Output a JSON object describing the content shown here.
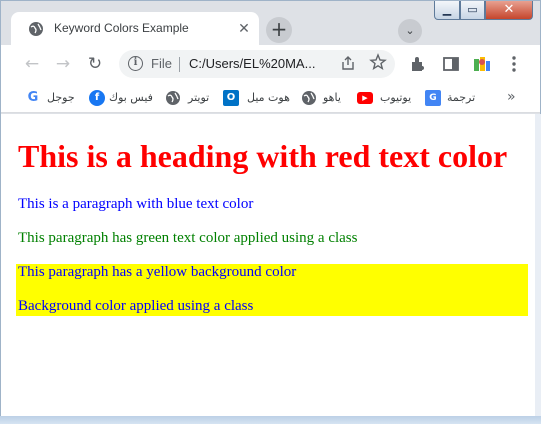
{
  "window": {
    "controls": {
      "minimize": "▁",
      "maximize": "▭",
      "close": "✕"
    }
  },
  "tab": {
    "title": "Keyword Colors Example",
    "favicon": "globe-icon",
    "close": "✕"
  },
  "tabstrip": {
    "new_tab": "+",
    "tab_search": "⌄"
  },
  "toolbar": {
    "back": "←",
    "forward": "→",
    "reload": "↻",
    "scheme": "File",
    "url": "C:/Users/EL%20MA...",
    "icons": [
      "share-icon",
      "bookmark-star-icon",
      "extensions-icon",
      "side-panel-icon",
      "profile-icon",
      "menu-icon"
    ]
  },
  "bookmarks": {
    "items": [
      {
        "label": "جوجل",
        "icon": "google-icon",
        "color": "#4285f4"
      },
      {
        "label": "فيس بوك",
        "icon": "facebook-icon",
        "color": "#1877f2"
      },
      {
        "label": "تويتر",
        "icon": "globe-icon",
        "color": "#5f6368"
      },
      {
        "label": "هوت ميل",
        "icon": "outlook-icon",
        "color": "#0072c6"
      },
      {
        "label": "ياهو",
        "icon": "globe-icon",
        "color": "#5f6368"
      },
      {
        "label": "يوتيوب",
        "icon": "youtube-icon",
        "color": "#ff0000"
      },
      {
        "label": "ترجمة",
        "icon": "google-translate-icon",
        "color": "#4285f4"
      }
    ],
    "more": "»"
  },
  "page": {
    "heading": "This is a heading with red text color",
    "p_blue": "This is a paragraph with blue text color",
    "p_green": "This paragraph has green text color applied using a class",
    "p_yellow_bg": "This paragraph has a yellow background color",
    "p_class_bg": "Background color applied using a class",
    "colors": {
      "heading": "#ff0000",
      "blue": "#0000ff",
      "green": "#008000",
      "yellow": "#ffff00"
    }
  }
}
